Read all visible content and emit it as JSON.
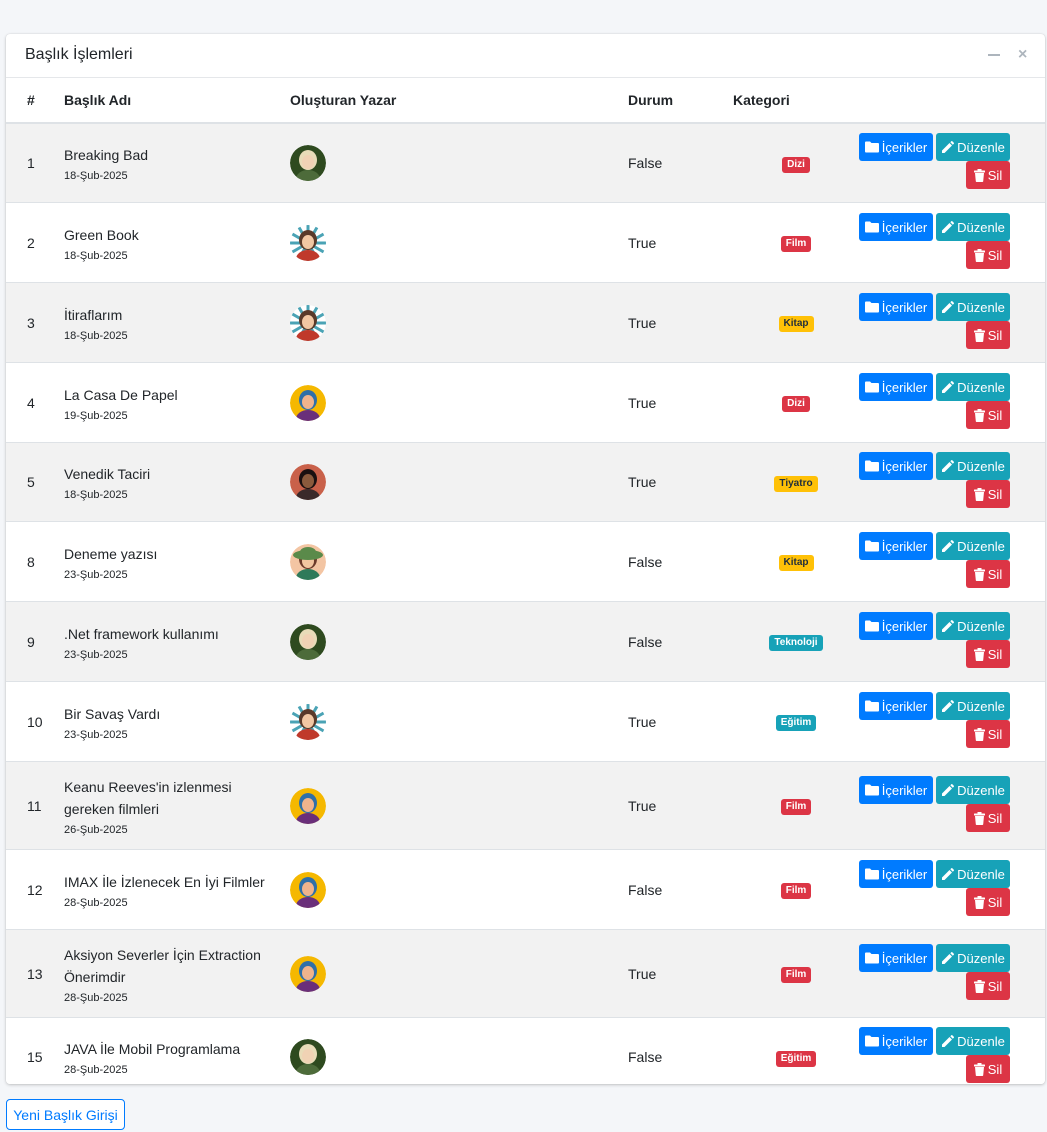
{
  "card": {
    "title": "Başlık İşlemleri",
    "minimize_icon": "minus-icon",
    "close_icon": "times-icon"
  },
  "table": {
    "headers": {
      "no": "#",
      "title": "Başlık Adı",
      "author": "Oluşturan Yazar",
      "status": "Durum",
      "category": "Kategori"
    },
    "rows": [
      {
        "no": "1",
        "title": "Breaking Bad",
        "date": "18-Şub-2025",
        "avatar": "avatar-blonde-green",
        "status": "False",
        "category": "Dizi",
        "category_color": "red"
      },
      {
        "no": "2",
        "title": "Green Book",
        "date": "18-Şub-2025",
        "avatar": "avatar-red-shirt",
        "status": "True",
        "category": "Film",
        "category_color": "red"
      },
      {
        "no": "3",
        "title": "İtiraflarım",
        "date": "18-Şub-2025",
        "avatar": "avatar-red-shirt",
        "status": "True",
        "category": "Kitap",
        "category_color": "yellow"
      },
      {
        "no": "4",
        "title": "La Casa De Papel",
        "date": "19-Şub-2025",
        "avatar": "avatar-yellow-glasses",
        "status": "True",
        "category": "Dizi",
        "category_color": "red"
      },
      {
        "no": "5",
        "title": "Venedik Taciri",
        "date": "18-Şub-2025",
        "avatar": "avatar-curly-hair",
        "status": "True",
        "category": "Tiyatro",
        "category_color": "yellow"
      },
      {
        "no": "8",
        "title": "Deneme yazısı",
        "date": "23-Şub-2025",
        "avatar": "avatar-sun-hat",
        "status": "False",
        "category": "Kitap",
        "category_color": "yellow"
      },
      {
        "no": "9",
        "title": ".Net framework kullanımı",
        "date": "23-Şub-2025",
        "avatar": "avatar-blonde-green",
        "status": "False",
        "category": "Teknoloji",
        "category_color": "teal"
      },
      {
        "no": "10",
        "title": "Bir Savaş Vardı",
        "date": "23-Şub-2025",
        "avatar": "avatar-red-shirt",
        "status": "True",
        "category": "Eğitim",
        "category_color": "teal"
      },
      {
        "no": "11",
        "title": "Keanu Reeves'in izlenmesi",
        "title2": "gereken filmleri",
        "date": "26-Şub-2025",
        "avatar": "avatar-yellow-glasses",
        "status": "True",
        "category": "Film",
        "category_color": "red"
      },
      {
        "no": "12",
        "title": "IMAX İle İzlenecek En İyi Filmler",
        "date": "28-Şub-2025",
        "avatar": "avatar-yellow-glasses",
        "status": "False",
        "category": "Film",
        "category_color": "red"
      },
      {
        "no": "13",
        "title": "Aksiyon Severler İçin Extraction",
        "title2": "Önerimdir",
        "date": "28-Şub-2025",
        "avatar": "avatar-yellow-glasses",
        "status": "True",
        "category": "Film",
        "category_color": "red"
      },
      {
        "no": "15",
        "title": "JAVA İle Mobil Programlama",
        "date": "28-Şub-2025",
        "avatar": "avatar-blonde-green",
        "status": "False",
        "category": "Eğitim",
        "category_color": "red"
      }
    ],
    "actions": {
      "contents_label": "İçerikler",
      "contents_icon": "folder-icon",
      "edit_label": "Düzenle",
      "edit_icon": "pencil-icon",
      "delete_label": "Sil",
      "delete_icon": "trash-icon"
    }
  },
  "new_button": "Yeni Başlık Girişi",
  "colors": {
    "primary": "#007bff",
    "info": "#17a2b8",
    "danger": "#dc3545",
    "warning": "#ffc107"
  }
}
